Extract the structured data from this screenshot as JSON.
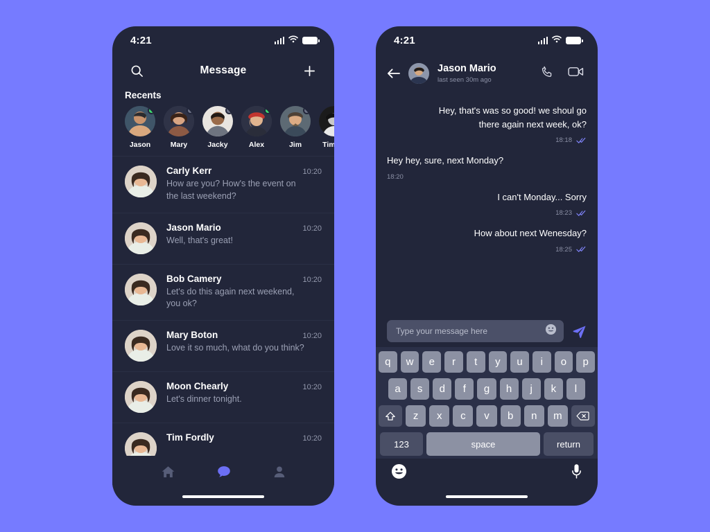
{
  "theme": {
    "background": "#767bff",
    "phone_surface": "#22263a",
    "accent": "#6c6ff5",
    "key_face": "#8c91a3",
    "key_dark": "#4a4f66",
    "online": "#3ddc6e",
    "offline": "#6d7287",
    "muted_text": "#9ba0b4"
  },
  "messages_screen": {
    "statusbar": {
      "time": "4:21"
    },
    "topbar": {
      "search_icon": "search-icon",
      "title": "Message",
      "add_icon": "plus-icon"
    },
    "recents": {
      "label": "Recents",
      "people": [
        {
          "name": "Jason",
          "status": "online"
        },
        {
          "name": "Mary",
          "status": "offline"
        },
        {
          "name": "Jacky",
          "status": "offline"
        },
        {
          "name": "Alex",
          "status": "online"
        },
        {
          "name": "Jim",
          "status": "offline"
        },
        {
          "name": "Timmy",
          "status": "offline"
        }
      ]
    },
    "conversations": [
      {
        "name": "Carly Kerr",
        "preview": "How are you? How's the event on the last weekend?",
        "time": "10:20"
      },
      {
        "name": "Jason Mario",
        "preview": "Well, that's great!",
        "time": "10:20"
      },
      {
        "name": "Bob Camery",
        "preview": "Let's do this again next weekend, you ok?",
        "time": "10:20"
      },
      {
        "name": "Mary Boton",
        "preview": "Love it so much, what do you think?",
        "time": "10:20"
      },
      {
        "name": "Moon Chearly",
        "preview": "Let's dinner tonight.",
        "time": "10:20"
      },
      {
        "name": "Tim Fordly",
        "preview": "",
        "time": "10:20"
      }
    ],
    "bottom_nav": [
      {
        "icon": "home-icon",
        "active": false
      },
      {
        "icon": "chat-bubble-icon",
        "active": true
      },
      {
        "icon": "person-icon",
        "active": false
      }
    ]
  },
  "chat_screen": {
    "statusbar": {
      "time": "4:21"
    },
    "header": {
      "back_icon": "back-arrow-icon",
      "name": "Jason Mario",
      "status": "last seen 30m  ago",
      "call_icon": "phone-icon",
      "video_icon": "video-camera-icon"
    },
    "thread": [
      {
        "text": "Hey, that's was so good! we shoul go there again next week, ok?",
        "side": "out",
        "time": "18:18",
        "ticks": true
      },
      {
        "text": "Hey hey, sure, next Monday?",
        "side": "in",
        "time": "18:20",
        "ticks": false
      },
      {
        "text": "I can't Monday... Sorry",
        "side": "out",
        "time": "18:23",
        "ticks": true
      },
      {
        "text": "How about next Wenesday?",
        "side": "out",
        "time": "18:25",
        "ticks": true
      }
    ],
    "composer": {
      "placeholder": "Type your message here",
      "value": "",
      "emoji_icon": "emoji-smiley-icon",
      "send_icon": "send-paper-plane-icon"
    },
    "keyboard": {
      "row1": [
        "q",
        "w",
        "e",
        "r",
        "t",
        "y",
        "u",
        "i",
        "o",
        "p"
      ],
      "row2": [
        "a",
        "s",
        "d",
        "f",
        "g",
        "h",
        "j",
        "k",
        "l"
      ],
      "row3_shift": "shift-icon",
      "row3": [
        "z",
        "x",
        "c",
        "v",
        "b",
        "n",
        "m"
      ],
      "row3_backspace": "backspace-icon",
      "numeric_label": "123",
      "space_label": "space",
      "return_label": "return",
      "emoji_key_icon": "emoji-face-icon",
      "mic_key_icon": "microphone-icon"
    }
  }
}
